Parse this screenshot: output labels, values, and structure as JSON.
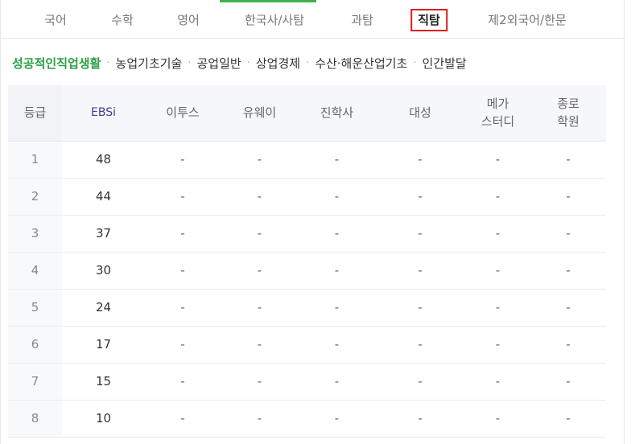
{
  "subject_tabs": [
    {
      "label": "국어"
    },
    {
      "label": "수학"
    },
    {
      "label": "영어"
    },
    {
      "label": "한국사/사탐"
    },
    {
      "label": "과탐"
    },
    {
      "label": "직탐"
    },
    {
      "label": "제2외국어/한문"
    }
  ],
  "selected_subject": "직탐",
  "sub_tabs": [
    {
      "label": "성공적인직업생활",
      "active": true
    },
    {
      "label": "농업기초기술"
    },
    {
      "label": "공업일반"
    },
    {
      "label": "상업경제"
    },
    {
      "label": "수산·해운산업기초"
    },
    {
      "label": "인간발달"
    }
  ],
  "sub_separator": "·",
  "table": {
    "headers": {
      "grade": "등급",
      "ebsi": "EBSi",
      "itos": "이투스",
      "uway": "유웨이",
      "jinhak": "진학사",
      "daesung": "대성",
      "mega_line1": "메가",
      "mega_line2": "스터디",
      "jongro_line1": "종로",
      "jongro_line2": "학원"
    },
    "rows": [
      {
        "grade": "1",
        "ebsi": "48",
        "itos": "-",
        "uway": "-",
        "jinhak": "-",
        "daesung": "-",
        "mega": "-",
        "jongro": "-"
      },
      {
        "grade": "2",
        "ebsi": "44",
        "itos": "-",
        "uway": "-",
        "jinhak": "-",
        "daesung": "-",
        "mega": "-",
        "jongro": "-"
      },
      {
        "grade": "3",
        "ebsi": "37",
        "itos": "-",
        "uway": "-",
        "jinhak": "-",
        "daesung": "-",
        "mega": "-",
        "jongro": "-"
      },
      {
        "grade": "4",
        "ebsi": "30",
        "itos": "-",
        "uway": "-",
        "jinhak": "-",
        "daesung": "-",
        "mega": "-",
        "jongro": "-"
      },
      {
        "grade": "5",
        "ebsi": "24",
        "itos": "-",
        "uway": "-",
        "jinhak": "-",
        "daesung": "-",
        "mega": "-",
        "jongro": "-"
      },
      {
        "grade": "6",
        "ebsi": "17",
        "itos": "-",
        "uway": "-",
        "jinhak": "-",
        "daesung": "-",
        "mega": "-",
        "jongro": "-"
      },
      {
        "grade": "7",
        "ebsi": "15",
        "itos": "-",
        "uway": "-",
        "jinhak": "-",
        "daesung": "-",
        "mega": "-",
        "jongro": "-"
      },
      {
        "grade": "8",
        "ebsi": "10",
        "itos": "-",
        "uway": "-",
        "jinhak": "-",
        "daesung": "-",
        "mega": "-",
        "jongro": "-"
      }
    ]
  },
  "colors": {
    "active_green": "#3cb44a",
    "selected_outline": "#e01a1a",
    "ebsi_header": "#3a3a9c"
  }
}
